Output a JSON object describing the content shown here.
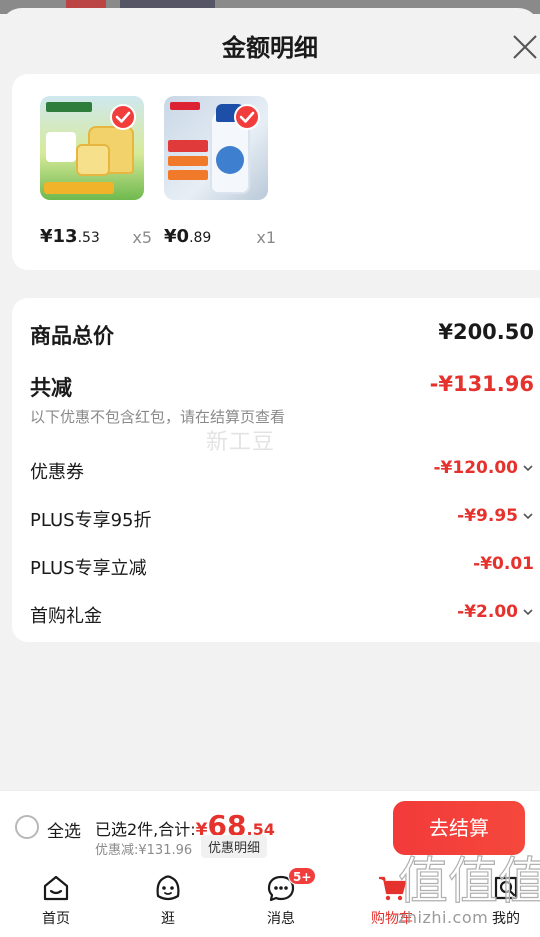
{
  "sheet": {
    "title": "金额明细"
  },
  "products": [
    {
      "price_int": "¥13",
      "price_dec": ".53",
      "qty": "x5",
      "thumb_color": "#d7ea9a"
    },
    {
      "price_int": "¥0",
      "price_dec": ".89",
      "qty": "x1",
      "thumb_color": "#e7eef5"
    }
  ],
  "breakdown": {
    "total_label": "商品总价",
    "total_value": "¥200.50",
    "reduce_label": "共减",
    "reduce_value": "-¥131.96",
    "note": "以下优惠不包含红包，请在结算页查看",
    "watermark": "新工豆",
    "items": [
      {
        "label": "优惠券",
        "value": "-¥120.00",
        "expandable": true
      },
      {
        "label": "PLUS专享95折",
        "value": "-¥9.95",
        "expandable": true
      },
      {
        "label": "PLUS专享立减",
        "value": "-¥0.01",
        "expandable": false
      },
      {
        "label": "首购礼金",
        "value": "-¥2.00",
        "expandable": true
      }
    ]
  },
  "checkout": {
    "select_all": "全选",
    "summary_prefix": "已选2件,合计:",
    "currency": "¥",
    "amount_int": "68",
    "amount_dec": ".54",
    "discount": "优惠减:¥131.96",
    "detail_chip": "优惠明细",
    "button": "去结算"
  },
  "tabs": [
    {
      "label": "首页",
      "icon": "home-icon"
    },
    {
      "label": "逛",
      "icon": "face-icon"
    },
    {
      "label": "消息",
      "icon": "message-icon",
      "badge": "5+"
    },
    {
      "label": "购物车",
      "icon": "cart-icon",
      "active": true
    },
    {
      "label": "我的",
      "icon": "profile-icon"
    }
  ],
  "watermark_site": {
    "logo": "值",
    "url": "zhizhi.com"
  },
  "colors": {
    "accent": "#e5322d",
    "button": "#f23a3a"
  }
}
